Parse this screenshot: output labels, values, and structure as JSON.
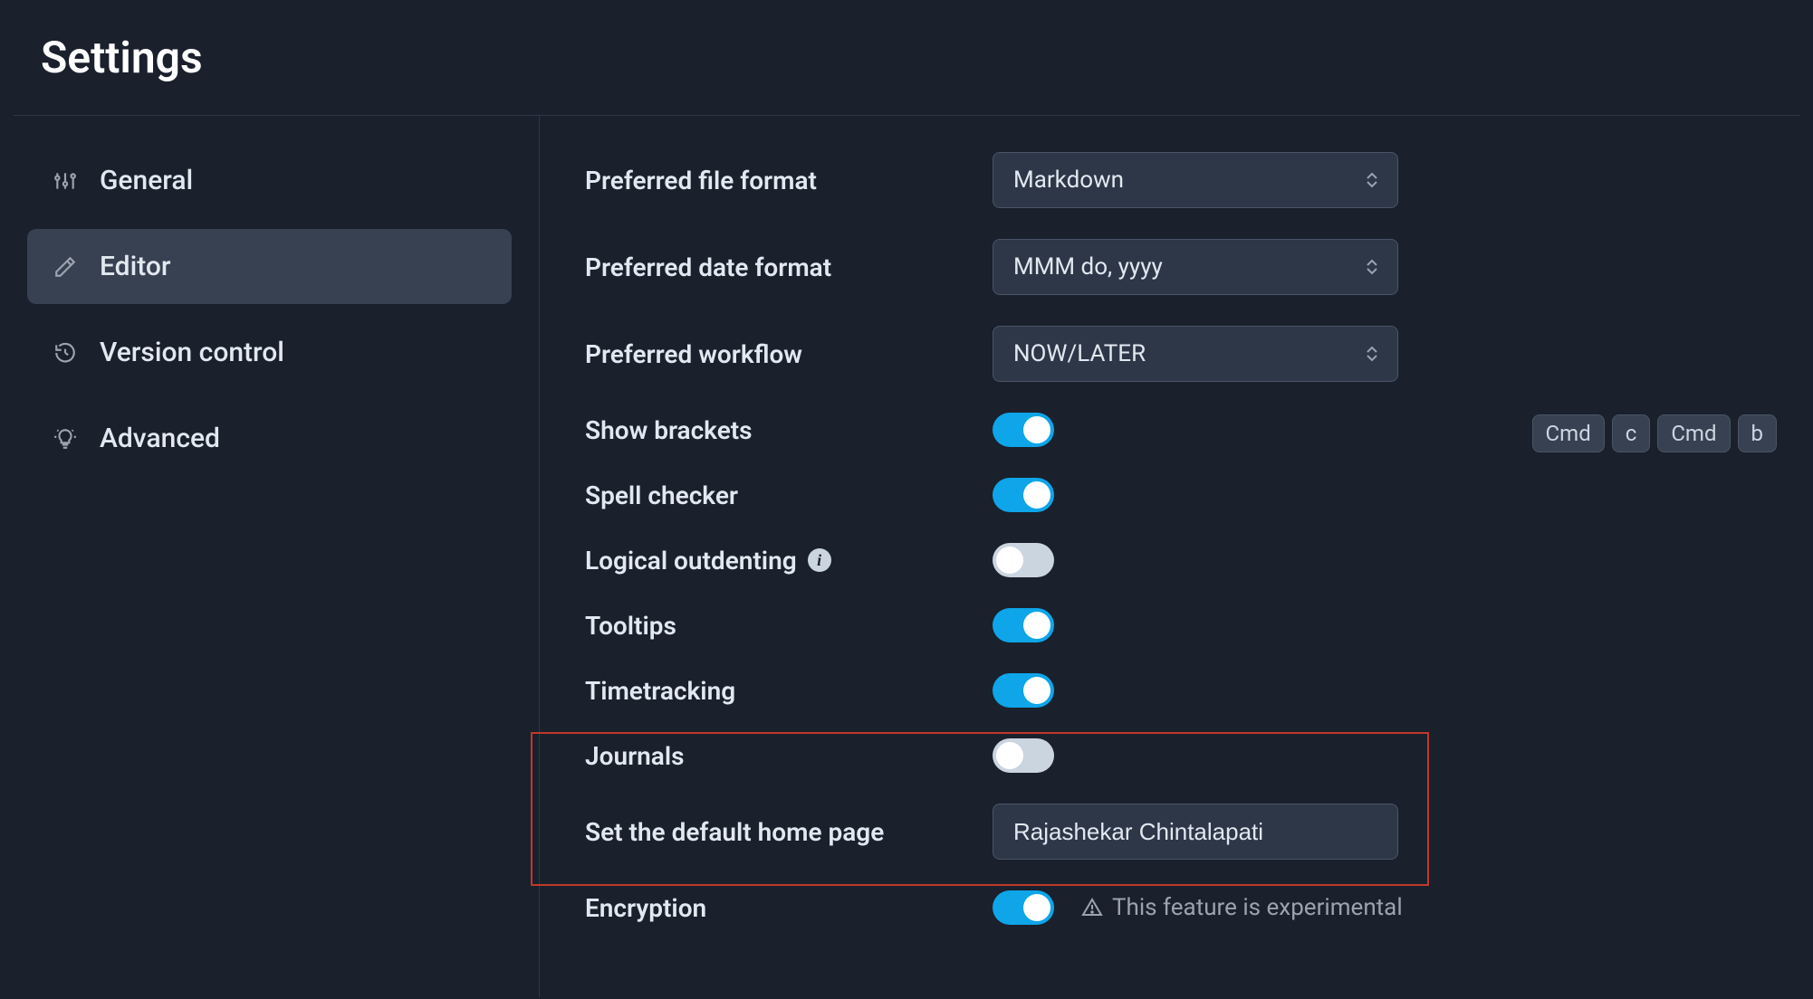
{
  "title": "Settings",
  "sidebar": {
    "items": [
      {
        "key": "general",
        "label": "General",
        "icon": "sliders-icon",
        "active": false
      },
      {
        "key": "editor",
        "label": "Editor",
        "icon": "pencil-ruler-icon",
        "active": true
      },
      {
        "key": "version-control",
        "label": "Version control",
        "icon": "history-icon",
        "active": false
      },
      {
        "key": "advanced",
        "label": "Advanced",
        "icon": "lightbulb-icon",
        "active": false
      }
    ]
  },
  "editor": {
    "preferred_file_format": {
      "label": "Preferred file format",
      "value": "Markdown"
    },
    "preferred_date_format": {
      "label": "Preferred date format",
      "value": "MMM do, yyyy"
    },
    "preferred_workflow": {
      "label": "Preferred workflow",
      "value": "NOW/LATER"
    },
    "show_brackets": {
      "label": "Show brackets",
      "on": true
    },
    "spell_checker": {
      "label": "Spell checker",
      "on": true
    },
    "logical_outdenting": {
      "label": "Logical outdenting",
      "on": false
    },
    "tooltips": {
      "label": "Tooltips",
      "on": true
    },
    "timetracking": {
      "label": "Timetracking",
      "on": true
    },
    "journals": {
      "label": "Journals",
      "on": false
    },
    "default_home_page": {
      "label": "Set the default home page",
      "value": "Rajashekar Chintalapati"
    },
    "encryption": {
      "label": "Encryption",
      "on": true,
      "warning": "This feature is experimental"
    }
  },
  "keyboard_hint": [
    "Cmd",
    "c",
    "Cmd",
    "b"
  ]
}
